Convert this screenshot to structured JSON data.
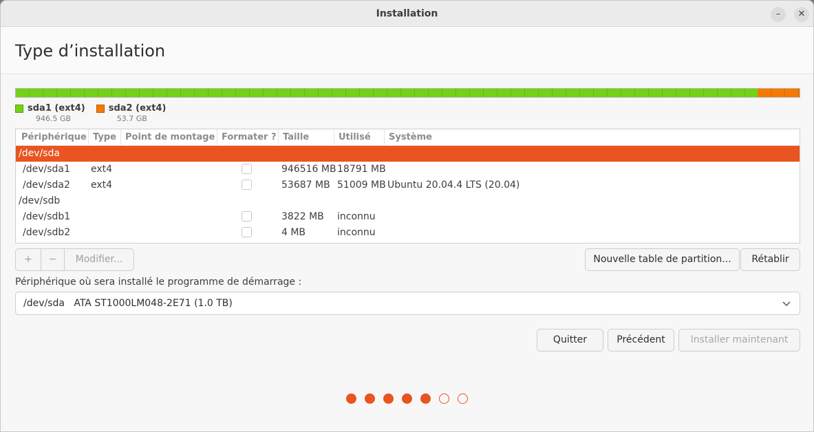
{
  "window": {
    "title": "Installation"
  },
  "page": {
    "title": "Type d’installation"
  },
  "partition_bar": {
    "segments": [
      {
        "label": "sda1 (ext4)",
        "size": "946.5 GB",
        "fraction": 0.9463,
        "color": "#73d216"
      },
      {
        "label": "sda2 (ext4)",
        "size": "53.7 GB",
        "fraction": 0.0537,
        "color": "#f57900"
      }
    ]
  },
  "table": {
    "columns": [
      "Périphérique",
      "Type",
      "Point de montage",
      "Formater ?",
      "Taille",
      "Utilisé",
      "Système"
    ],
    "rows": [
      {
        "device": "/dev/sda",
        "type": "",
        "mount": "",
        "checkbox": false,
        "size": "",
        "used": "",
        "system": "",
        "selected": true
      },
      {
        "device": "/dev/sda1",
        "type": "ext4",
        "mount": "",
        "checkbox": true,
        "size": "946516 MB",
        "used": "18791 MB",
        "system": "",
        "selected": false
      },
      {
        "device": "/dev/sda2",
        "type": "ext4",
        "mount": "",
        "checkbox": true,
        "size": "53687 MB",
        "used": "51009 MB",
        "system": "Ubuntu 20.04.4 LTS (20.04)",
        "selected": false
      },
      {
        "device": "/dev/sdb",
        "type": "",
        "mount": "",
        "checkbox": false,
        "size": "",
        "used": "",
        "system": "",
        "selected": false
      },
      {
        "device": "/dev/sdb1",
        "type": "",
        "mount": "",
        "checkbox": true,
        "size": "3822 MB",
        "used": "inconnu",
        "system": "",
        "selected": false
      },
      {
        "device": "/dev/sdb2",
        "type": "",
        "mount": "",
        "checkbox": true,
        "size": "4 MB",
        "used": "inconnu",
        "system": "",
        "selected": false
      }
    ]
  },
  "toolbar": {
    "add_label": "+",
    "remove_label": "−",
    "modify_label": "Modifier...",
    "new_table_label": "Nouvelle table de partition...",
    "revert_label": "Rétablir"
  },
  "boot": {
    "label": "Périphérique où sera installé le programme de démarrage :",
    "device": "/dev/sda",
    "description": "ATA ST1000LM048-2E71 (1.0 TB)"
  },
  "actions": {
    "quit_label": "Quitter",
    "back_label": "Précédent",
    "install_label": "Installer maintenant"
  },
  "progress": {
    "total_steps": 7,
    "completed_steps": 5
  },
  "colors": {
    "accent": "#e95420"
  },
  "icons": {
    "minimize": "minimize-icon",
    "close": "close-icon",
    "dropdown": "chevron-down-icon"
  }
}
